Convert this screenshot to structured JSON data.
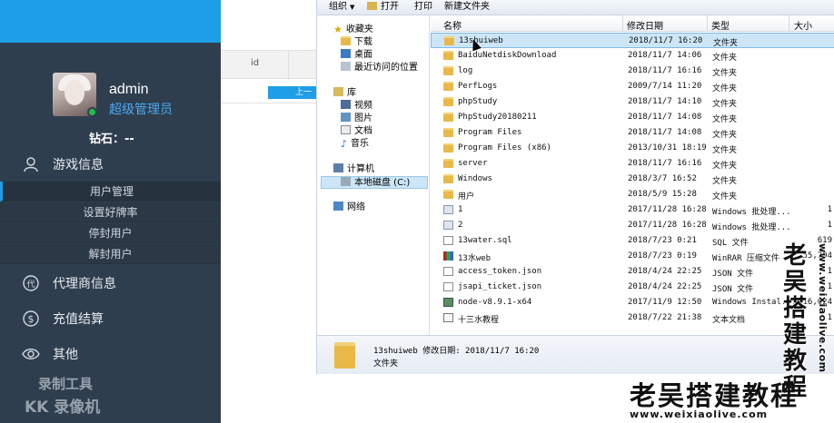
{
  "sidebar": {
    "user_name": "admin",
    "user_role": "超级管理员",
    "diamond": "钻石：--",
    "menu": [
      {
        "label": "游戏信息",
        "icon": "user-icon"
      },
      {
        "label": "代理商信息",
        "icon": "agent-icon"
      },
      {
        "label": "充值结算",
        "icon": "dollar-icon"
      },
      {
        "label": "其他",
        "icon": "eye-icon"
      }
    ],
    "submenu": [
      "用户管理",
      "设置好牌率",
      "停封用户",
      "解封用户"
    ],
    "recorder_line1": "录制工具",
    "recorder_line2": "KK 录像机"
  },
  "admin_table": {
    "col_id": "id",
    "btn_label": "上一"
  },
  "explorer": {
    "toolbar": {
      "organize": "组织",
      "open": "打开",
      "print": "打印",
      "new_folder": "新建文件夹"
    },
    "nav": {
      "favorites": "收藏夹",
      "downloads": "下载",
      "desktop": "桌面",
      "recent": "最近访问的位置",
      "libraries": "库",
      "videos": "视频",
      "pictures": "图片",
      "documents": "文档",
      "music": "音乐",
      "computer": "计算机",
      "local_disk": "本地磁盘 (C:)",
      "network": "网络"
    },
    "columns": {
      "name": "名称",
      "modified": "修改日期",
      "type": "类型",
      "size": "大小"
    },
    "files": [
      {
        "name": "13shuiweb",
        "date": "2018/11/7 16:20",
        "type": "文件夹",
        "size": "",
        "kind": "folder"
      },
      {
        "name": "BaiduNetdiskDownload",
        "date": "2018/11/7 14:06",
        "type": "文件夹",
        "size": "",
        "kind": "folder"
      },
      {
        "name": "log",
        "date": "2018/11/7 16:16",
        "type": "文件夹",
        "size": "",
        "kind": "folder"
      },
      {
        "name": "PerfLogs",
        "date": "2009/7/14 11:20",
        "type": "文件夹",
        "size": "",
        "kind": "folder"
      },
      {
        "name": "phpStudy",
        "date": "2018/11/7 14:10",
        "type": "文件夹",
        "size": "",
        "kind": "folder"
      },
      {
        "name": "PhpStudy20180211",
        "date": "2018/11/7 14:08",
        "type": "文件夹",
        "size": "",
        "kind": "folder"
      },
      {
        "name": "Program Files",
        "date": "2018/11/7 14:08",
        "type": "文件夹",
        "size": "",
        "kind": "folder"
      },
      {
        "name": "Program Files (x86)",
        "date": "2013/10/31 18:19",
        "type": "文件夹",
        "size": "",
        "kind": "folder"
      },
      {
        "name": "server",
        "date": "2018/11/7 16:16",
        "type": "文件夹",
        "size": "",
        "kind": "folder"
      },
      {
        "name": "Windows",
        "date": "2018/3/7 16:52",
        "type": "文件夹",
        "size": "",
        "kind": "folder"
      },
      {
        "name": "用户",
        "date": "2018/5/9 15:28",
        "type": "文件夹",
        "size": "",
        "kind": "folder"
      },
      {
        "name": "1",
        "date": "2017/11/28 16:28",
        "type": "Windows 批处理...",
        "size": "1",
        "kind": "batch"
      },
      {
        "name": "2",
        "date": "2017/11/28 16:28",
        "type": "Windows 批处理...",
        "size": "1",
        "kind": "batch"
      },
      {
        "name": "13water.sql",
        "date": "2018/7/23 0:21",
        "type": "SQL 文件",
        "size": "619",
        "kind": "doc"
      },
      {
        "name": "13水web",
        "date": "2018/7/23 0:19",
        "type": "WinRAR 压缩文件",
        "size": "55,794",
        "kind": "rar"
      },
      {
        "name": "access_token.json",
        "date": "2018/4/24 22:25",
        "type": "JSON 文件",
        "size": "1",
        "kind": "doc"
      },
      {
        "name": "jsapi_ticket.json",
        "date": "2018/4/24 22:25",
        "type": "JSON 文件",
        "size": "1",
        "kind": "doc"
      },
      {
        "name": "node-v8.9.1-x64",
        "date": "2017/11/9 12:50",
        "type": "Windows Instal...",
        "size": "16,024",
        "kind": "msi"
      },
      {
        "name": "十三水教程",
        "date": "2018/7/22 21:38",
        "type": "文本文档",
        "size": "1",
        "kind": "txt"
      }
    ],
    "details": {
      "name": "13shuiweb",
      "modified_label": "修改日期:",
      "modified": "2018/11/7 16:20",
      "type": "文件夹"
    }
  },
  "watermark": {
    "title": "老吴搭建教程",
    "url": "www.weixiaolive.com",
    "vertical": [
      "老",
      "吴",
      "搭",
      "建",
      "教",
      "程"
    ],
    "vertical_url": "www.weixiaolive.com"
  }
}
